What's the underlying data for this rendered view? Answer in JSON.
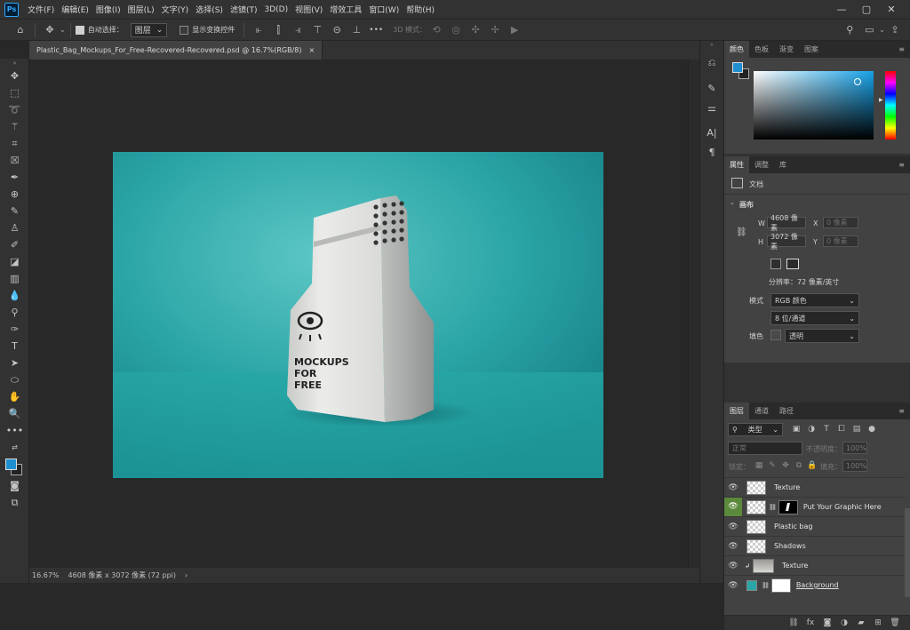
{
  "app": {
    "logo": "Ps"
  },
  "menu": [
    "文件(F)",
    "编辑(E)",
    "图像(I)",
    "图层(L)",
    "文字(Y)",
    "选择(S)",
    "滤镜(T)",
    "3D(D)",
    "视图(V)",
    "增效工具",
    "窗口(W)",
    "帮助(H)"
  ],
  "window_controls": {
    "minimize": "—",
    "restore": "▢",
    "close": "✕"
  },
  "options": {
    "auto_select_label": "自动选择：",
    "auto_select_value": "图层",
    "show_transform_label": "显示变换控件",
    "mode_3d_label": "3D 模式：",
    "more": "•••"
  },
  "document_tab": {
    "title": "Plastic_Bag_Mockups_For_Free-Recovered-Recovered.psd @ 16.7%(RGB/8)",
    "close": "×"
  },
  "status": {
    "zoom": "16.67%",
    "info": "4608 像素 x 3072 像素 (72 ppi)",
    "arrow": "›"
  },
  "bag": {
    "line1": "MOCKUPS",
    "line2": "FOR",
    "line3": "FREE"
  },
  "color_panel": {
    "tabs": [
      "颜色",
      "色板",
      "渐变",
      "图案"
    ],
    "fg": "#1f8fd0",
    "bg": "#222222"
  },
  "props_panel": {
    "tabs": [
      "属性",
      "调整",
      "库"
    ],
    "doc_label": "文档",
    "section": "画布",
    "w_label": "W",
    "w_value": "4608 像素",
    "x_label": "X",
    "x_placeholder": "0 像素",
    "h_label": "H",
    "h_value": "3072 像素",
    "y_label": "Y",
    "y_placeholder": "0 像素",
    "resolution": "分辨率：72 像素/英寸",
    "mode_label": "模式",
    "mode_value": "RGB 颜色",
    "depth_value": "8 位/通道",
    "fill_label": "填色",
    "fill_value": "透明"
  },
  "layers_panel": {
    "tabs": [
      "图层",
      "通道",
      "路径"
    ],
    "filter": "类型",
    "blend": "正常",
    "opacity_label": "不透明度：",
    "opacity_value": "100%",
    "lock_label": "锁定：",
    "fill_label": "填充：",
    "fill_value": "100%",
    "layers": [
      {
        "name": "Texture"
      },
      {
        "name": "Put Your Graphic Here"
      },
      {
        "name": "Plastic bag"
      },
      {
        "name": "Shadows"
      },
      {
        "name": "Texture"
      },
      {
        "name": "Background"
      }
    ]
  },
  "colors": {
    "teal": "#2aa6a6",
    "accent": "#31a8ff"
  }
}
